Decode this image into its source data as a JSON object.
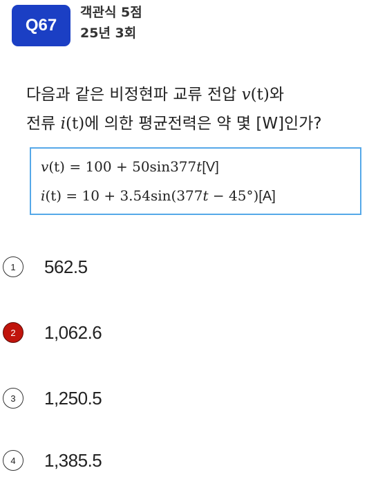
{
  "header": {
    "badge": "Q67",
    "type": "객관식 5점",
    "session": "25년 3회"
  },
  "question": {
    "l1_a": "다음과 같은 비정현파 교류 전압 ",
    "l1_var": "v",
    "l1_arg": "(t)",
    "l1_b": "와",
    "l2_a": "전류 ",
    "l2_var": "i",
    "l2_arg": "(t)",
    "l2_b": "에 의한 평균전력은 약 몇 [W]인가?"
  },
  "formulas": {
    "f1_lhs": "v",
    "f1_arg": "(t)",
    "f1_rhs": " = 100 + 50sin377",
    "f1_t": "t",
    "f1_unit": "[V]",
    "f2_lhs": "i",
    "f2_arg": "(t)",
    "f2_rhs": " = 10 + 3.54sin(377",
    "f2_t": "t",
    "f2_rest": " − 45°)",
    "f2_unit": "[A]"
  },
  "options": [
    {
      "num": "1",
      "text": "562.5",
      "selected": false
    },
    {
      "num": "2",
      "text": "1,062.6",
      "selected": true
    },
    {
      "num": "3",
      "text": "1,250.5",
      "selected": false
    },
    {
      "num": "4",
      "text": "1,385.5",
      "selected": false
    }
  ],
  "colors": {
    "badge": "#1b3fc4",
    "box_border": "#55a8e8",
    "selected": "#c0140c"
  }
}
